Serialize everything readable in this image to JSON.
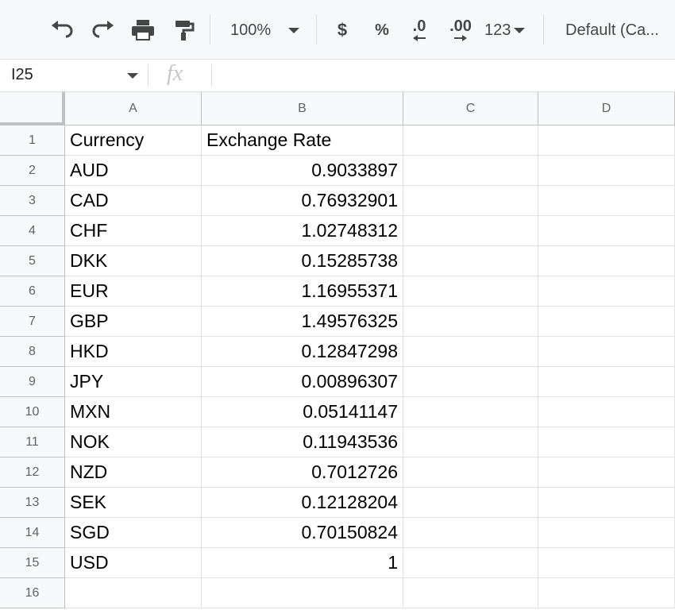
{
  "toolbar": {
    "zoom": "100%",
    "currency_symbol": "$",
    "percent_symbol": "%",
    "decrease_decimal": ".0",
    "increase_decimal": ".00",
    "more_formats": "123",
    "font": "Default (Ca..."
  },
  "formula_bar": {
    "cell_ref": "I25",
    "fx": "fx"
  },
  "columns": [
    "A",
    "B",
    "C",
    "D"
  ],
  "rows": [
    {
      "num": "1",
      "a": "Currency",
      "b": "Exchange Rate",
      "b_type": "text"
    },
    {
      "num": "2",
      "a": "AUD",
      "b": "0.9033897"
    },
    {
      "num": "3",
      "a": "CAD",
      "b": "0.76932901"
    },
    {
      "num": "4",
      "a": "CHF",
      "b": "1.02748312"
    },
    {
      "num": "5",
      "a": "DKK",
      "b": "0.15285738"
    },
    {
      "num": "6",
      "a": "EUR",
      "b": "1.16955371"
    },
    {
      "num": "7",
      "a": "GBP",
      "b": "1.49576325"
    },
    {
      "num": "8",
      "a": "HKD",
      "b": "0.12847298"
    },
    {
      "num": "9",
      "a": "JPY",
      "b": "0.00896307"
    },
    {
      "num": "10",
      "a": "MXN",
      "b": "0.05141147"
    },
    {
      "num": "11",
      "a": "NOK",
      "b": "0.11943536"
    },
    {
      "num": "12",
      "a": "NZD",
      "b": "0.7012726"
    },
    {
      "num": "13",
      "a": "SEK",
      "b": "0.12128204"
    },
    {
      "num": "14",
      "a": "SGD",
      "b": "0.70150824"
    },
    {
      "num": "15",
      "a": "USD",
      "b": "1"
    },
    {
      "num": "16",
      "a": "",
      "b": ""
    }
  ]
}
